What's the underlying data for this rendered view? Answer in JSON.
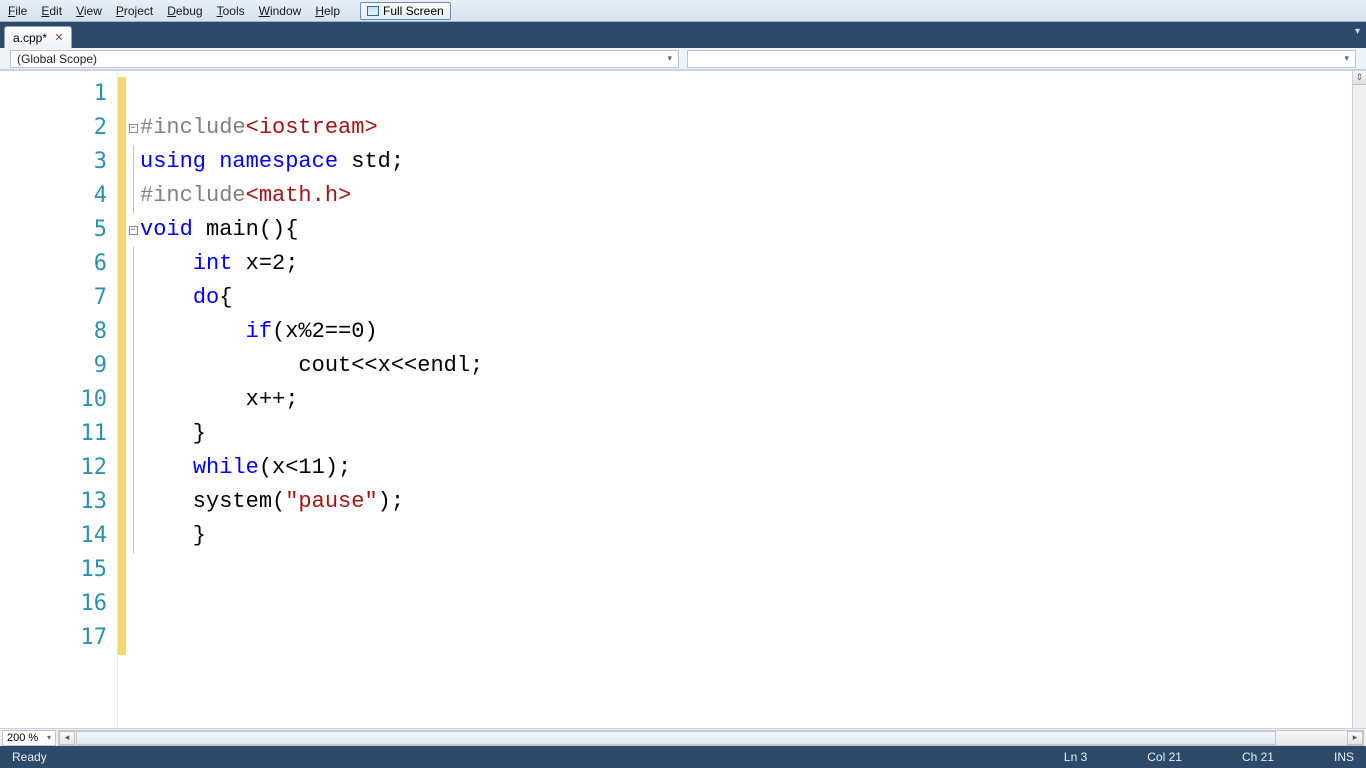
{
  "menu": {
    "items": [
      {
        "u": "F",
        "rest": "ile"
      },
      {
        "u": "E",
        "rest": "dit"
      },
      {
        "u": "V",
        "rest": "iew"
      },
      {
        "u": "P",
        "rest": "roject"
      },
      {
        "u": "D",
        "rest": "ebug"
      },
      {
        "u": "T",
        "rest": "ools"
      },
      {
        "u": "W",
        "rest": "indow"
      },
      {
        "u": "H",
        "rest": "elp"
      }
    ],
    "fullscreen": "Full Screen"
  },
  "tabs": {
    "active": "a.cpp*"
  },
  "scope": {
    "left": "(Global Scope)",
    "right": ""
  },
  "editor": {
    "zoom": "200 %",
    "lines": [
      {
        "n": 1,
        "fold": "",
        "chg": true,
        "html": ""
      },
      {
        "n": 2,
        "fold": "minus",
        "chg": true,
        "html": "<span class='pp'>#include</span><span class='inc'>&lt;iostream&gt;</span>"
      },
      {
        "n": 3,
        "fold": "line",
        "chg": true,
        "html": "<span class='kw'>using</span> <span class='kw'>namespace</span> std;"
      },
      {
        "n": 4,
        "fold": "line",
        "chg": true,
        "html": "<span class='pp'>#include</span><span class='inc'>&lt;math.h&gt;</span>"
      },
      {
        "n": 5,
        "fold": "minus",
        "chg": true,
        "html": "<span class='kw'>void</span> main(){"
      },
      {
        "n": 6,
        "fold": "line",
        "chg": true,
        "html": "    <span class='kw'>int</span> x=2;"
      },
      {
        "n": 7,
        "fold": "line",
        "chg": true,
        "html": "    <span class='kw'>do</span>{"
      },
      {
        "n": 8,
        "fold": "line",
        "chg": true,
        "html": "        <span class='kw'>if</span>(x%2==0)"
      },
      {
        "n": 9,
        "fold": "line",
        "chg": true,
        "html": "            cout&lt;&lt;x&lt;&lt;endl;"
      },
      {
        "n": 10,
        "fold": "line",
        "chg": true,
        "html": "        x++;"
      },
      {
        "n": 11,
        "fold": "line",
        "chg": true,
        "html": "    }"
      },
      {
        "n": 12,
        "fold": "line",
        "chg": true,
        "html": "    <span class='kw'>while</span>(x&lt;11);"
      },
      {
        "n": 13,
        "fold": "line",
        "chg": true,
        "html": "    system(<span class='str'>\"pause\"</span>);"
      },
      {
        "n": 14,
        "fold": "line",
        "chg": true,
        "html": "    }"
      },
      {
        "n": 15,
        "fold": "",
        "chg": true,
        "html": ""
      },
      {
        "n": 16,
        "fold": "",
        "chg": true,
        "html": ""
      },
      {
        "n": 17,
        "fold": "",
        "chg": true,
        "html": ""
      }
    ]
  },
  "status": {
    "ready": "Ready",
    "ln": "Ln 3",
    "col": "Col 21",
    "ch": "Ch 21",
    "ins": "INS"
  }
}
